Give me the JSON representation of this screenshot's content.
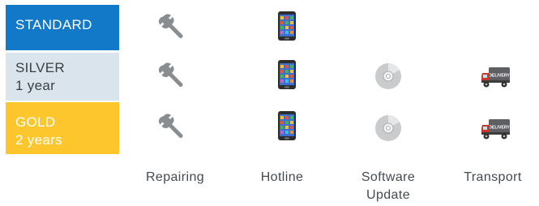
{
  "tiers": [
    {
      "name": "STANDARD",
      "duration": ""
    },
    {
      "name": "SILVER",
      "duration": "1 year"
    },
    {
      "name": "GOLD",
      "duration": "2 years"
    }
  ],
  "features": [
    {
      "label": "Repairing",
      "icon": "wrench-icon"
    },
    {
      "label": "Hotline",
      "icon": "phone-icon"
    },
    {
      "label_line1": "Software",
      "label_line2": "Update",
      "icon": "disc-icon"
    },
    {
      "label": "Transport",
      "icon": "delivery-truck-icon"
    }
  ],
  "truck_text": "DELIVERY",
  "colors": {
    "standard": "#1279c9",
    "silver": "#d9e4ec",
    "gold": "#fdc62d",
    "wrench": "#8a8d90",
    "phone": "#2d2d2d",
    "disc": "#c9cbcd",
    "truck_cab": "#c8372c",
    "truck_box": "#5d5f62"
  }
}
